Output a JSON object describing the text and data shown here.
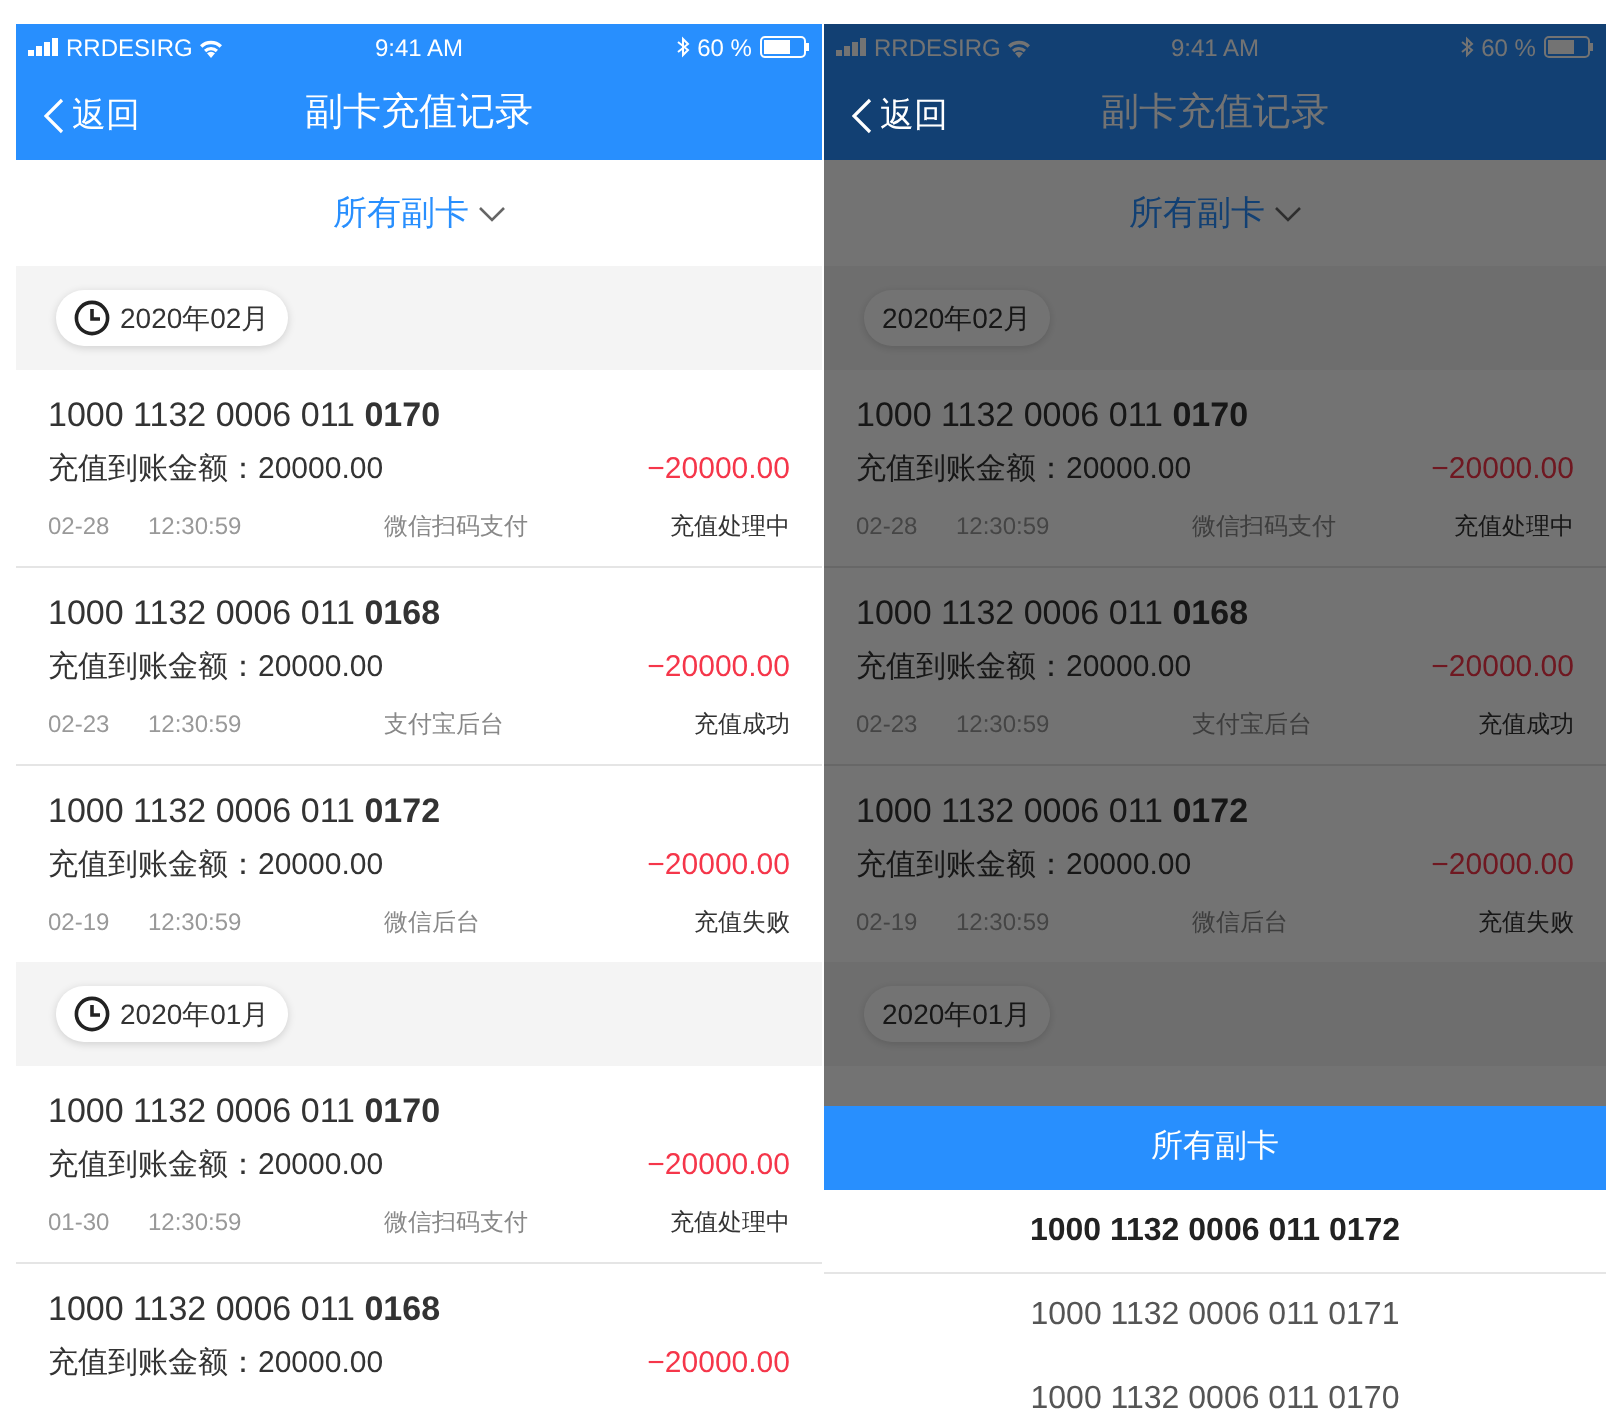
{
  "screens": [
    {
      "status_bar": {
        "carrier": "RRDESIRG",
        "time": "9:41 AM",
        "battery": "60 %"
      },
      "nav": {
        "back": "返回",
        "title": "副卡充值记录"
      },
      "filter": "所有副卡",
      "dimmed": false,
      "groups": [
        {
          "month": "2020年02月",
          "icon": true,
          "records": [
            {
              "card": "1000 1132 0006 011 **0170**",
              "amount_label": "充值到账金额：20000.00",
              "amount": "−20000.00",
              "date": "02-28",
              "time": "12:30:59",
              "channel": "微信扫码支付",
              "status": "充值处理中"
            },
            {
              "card": "1000 1132 0006 011 **0168**",
              "amount_label": "充值到账金额：20000.00",
              "amount": "−20000.00",
              "date": "02-23",
              "time": "12:30:59",
              "channel": "支付宝后台",
              "status": "充值成功"
            },
            {
              "card": "1000 1132 0006 011 **0172**",
              "amount_label": "充值到账金额：20000.00",
              "amount": "−20000.00",
              "date": "02-19",
              "time": "12:30:59",
              "channel": "微信后台",
              "status": "充值失败"
            }
          ]
        },
        {
          "month": "2020年01月",
          "icon": true,
          "records": [
            {
              "card": "1000 1132 0006 011 **0170**",
              "amount_label": "充值到账金额：20000.00",
              "amount": "−20000.00",
              "date": "01-30",
              "time": "12:30:59",
              "channel": "微信扫码支付",
              "status": "充值处理中"
            },
            {
              "card": "1000 1132 0006 011 **0168**",
              "amount_label": "充值到账金额：20000.00",
              "amount": "−20000.00"
            }
          ]
        }
      ]
    },
    {
      "status_bar": {
        "carrier": "RRDESIRG",
        "time": "9:41 AM",
        "battery": "60 %"
      },
      "nav": {
        "back": "返回",
        "title": "副卡充值记录"
      },
      "filter": "所有副卡",
      "dimmed": true,
      "groups": [
        {
          "month": "2020年02月",
          "icon": false,
          "records": [
            {
              "card": "1000 1132 0006 011 **0170**",
              "amount_label": "充值到账金额：20000.00",
              "amount": "−20000.00",
              "date": "02-28",
              "time": "12:30:59",
              "channel": "微信扫码支付",
              "status": "充值处理中"
            },
            {
              "card": "1000 1132 0006 011 **0168**",
              "amount_label": "充值到账金额：20000.00",
              "amount": "−20000.00",
              "date": "02-23",
              "time": "12:30:59",
              "channel": "支付宝后台",
              "status": "充值成功"
            },
            {
              "card": "1000 1132 0006 011 **0172**",
              "amount_label": "充值到账金额：20000.00",
              "amount": "−20000.00",
              "date": "02-19",
              "time": "12:30:59",
              "channel": "微信后台",
              "status": "充值失败"
            }
          ]
        },
        {
          "month": "2020年01月",
          "icon": false
        }
      ],
      "sheet": {
        "title": "所有副卡",
        "items": [
          {
            "label": "1000 1132 0006 011 0172",
            "selected": true
          },
          {
            "label": "1000 1132 0006 011 0171",
            "selected": false
          },
          {
            "label": "1000 1132 0006 011 0170",
            "selected": false
          }
        ]
      }
    }
  ]
}
